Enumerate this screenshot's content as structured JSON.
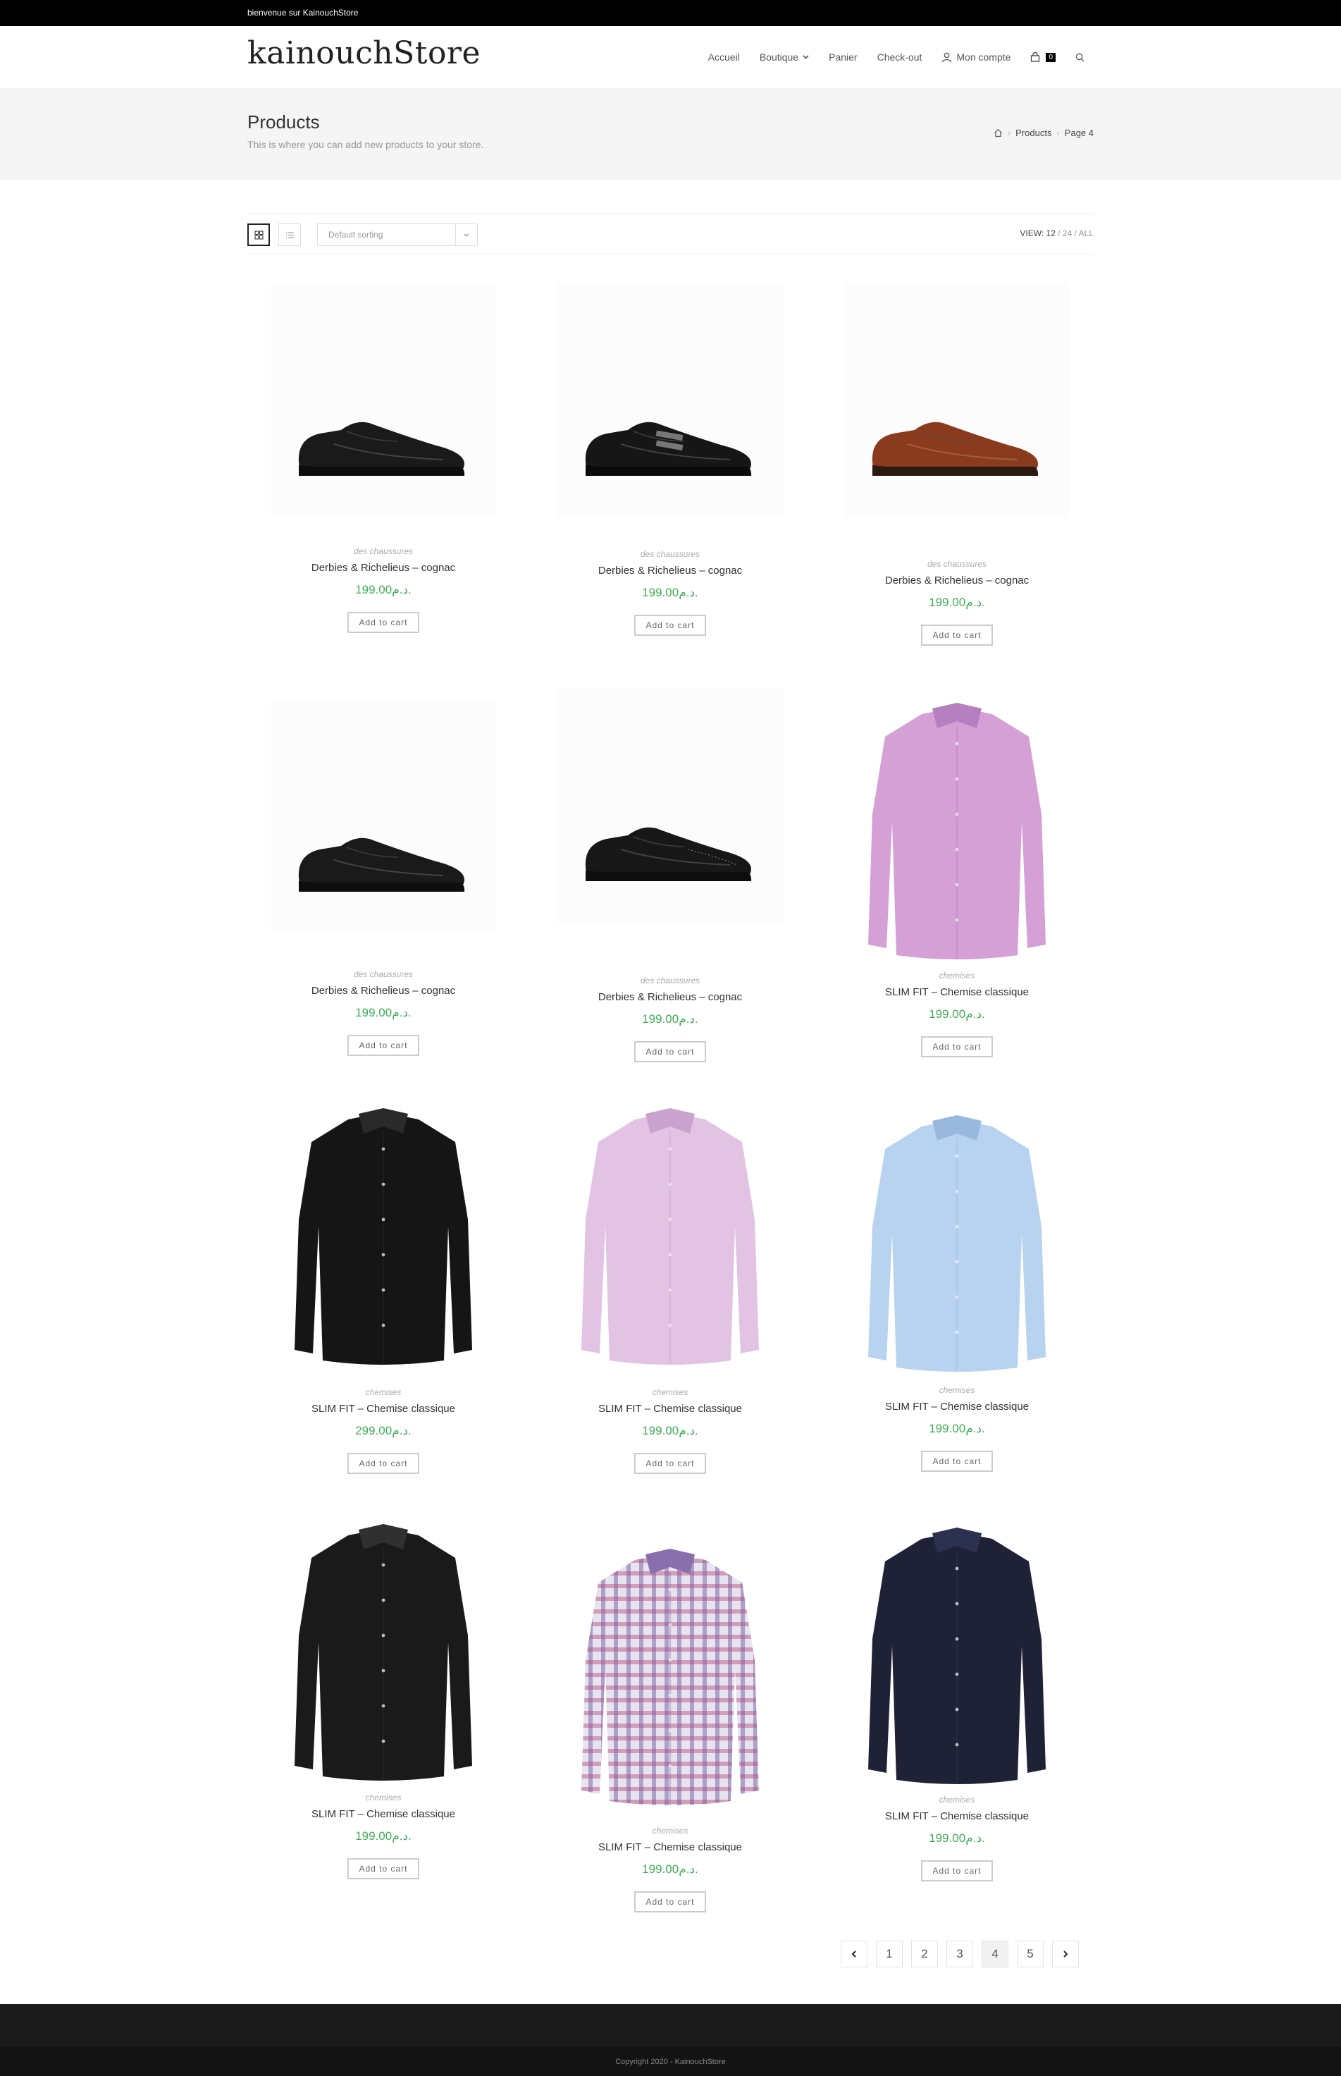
{
  "topbar": {
    "text": "bienvenue sur KainouchStore"
  },
  "header": {
    "logo": "kainouchStore",
    "nav": [
      "Accueil",
      "Boutique",
      "Panier",
      "Check-out",
      "Mon compte"
    ],
    "cart_count": "0"
  },
  "pagehead": {
    "title": "Products",
    "subtitle": "This is where you can add new products to your store.",
    "breadcrumb": [
      "Products",
      "Page 4"
    ]
  },
  "toolbar": {
    "sort": "Default sorting",
    "view_label": "VIEW:",
    "view_options": [
      "12",
      "24",
      "ALL"
    ]
  },
  "products": [
    {
      "category": "des chaussures",
      "name": "Derbies & Richelieus – cognac",
      "price": "199.00د.م.",
      "button": "Add to cart"
    },
    {
      "category": "des chaussures",
      "name": "Derbies & Richelieus – cognac",
      "price": "199.00د.م.",
      "button": "Add to cart"
    },
    {
      "category": "des chaussures",
      "name": "Derbies & Richelieus – cognac",
      "price": "199.00د.م.",
      "button": "Add to cart"
    },
    {
      "category": "des chaussures",
      "name": "Derbies & Richelieus – cognac",
      "price": "199.00د.م.",
      "button": "Add to cart"
    },
    {
      "category": "des chaussures",
      "name": "Derbies & Richelieus – cognac",
      "price": "199.00د.م.",
      "button": "Add to cart"
    },
    {
      "category": "chemises",
      "name": "SLIM FIT – Chemise classique",
      "price": "199.00د.م.",
      "button": "Add to cart"
    },
    {
      "category": "chemises",
      "name": "SLIM FIT – Chemise classique",
      "price": "299.00د.م.",
      "button": "Add to cart"
    },
    {
      "category": "chemises",
      "name": "SLIM FIT – Chemise classique",
      "price": "199.00د.م.",
      "button": "Add to cart"
    },
    {
      "category": "chemises",
      "name": "SLIM FIT – Chemise classique",
      "price": "199.00د.م.",
      "button": "Add to cart"
    },
    {
      "category": "chemises",
      "name": "SLIM FIT – Chemise classique",
      "price": "199.00د.م.",
      "button": "Add to cart"
    },
    {
      "category": "chemises",
      "name": "SLIM FIT – Chemise classique",
      "price": "199.00د.م.",
      "button": "Add to cart"
    },
    {
      "category": "chemises",
      "name": "SLIM FIT – Chemise classique",
      "price": "199.00د.م.",
      "button": "Add to cart"
    }
  ],
  "pagination": {
    "pages": [
      "1",
      "2",
      "3",
      "4",
      "5"
    ],
    "current": "4"
  },
  "footer": {
    "copyright": "Copyright 2020 - KainouchStore"
  }
}
